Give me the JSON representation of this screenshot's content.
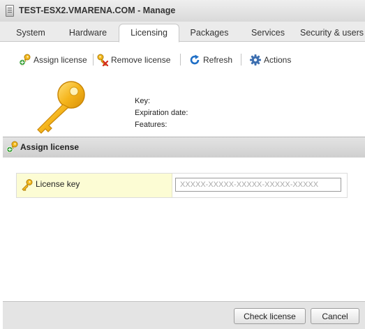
{
  "window": {
    "title": "TEST-ESX2.VMARENA.COM - Manage"
  },
  "tabs": [
    {
      "label": "System"
    },
    {
      "label": "Hardware"
    },
    {
      "label": "Licensing"
    },
    {
      "label": "Packages"
    },
    {
      "label": "Services"
    },
    {
      "label": "Security & users"
    }
  ],
  "active_tab": "Licensing",
  "toolbar": {
    "assign_label": "Assign license",
    "remove_label": "Remove license",
    "refresh_label": "Refresh",
    "actions_label": "Actions"
  },
  "license_info": {
    "key_label": "Key:",
    "expiration_label": "Expiration date:",
    "features_label": "Features:"
  },
  "dialog": {
    "title": "Assign license",
    "field_label": "License key",
    "placeholder": "XXXXX-XXXXX-XXXXX-XXXXX-XXXXX",
    "value": ""
  },
  "footer": {
    "check_label": "Check license",
    "cancel_label": "Cancel"
  },
  "icons": {
    "host": "host-icon",
    "assign": "key-plus-icon",
    "remove": "key-x-icon",
    "refresh": "refresh-icon",
    "actions": "gear-icon",
    "license": "key-icon"
  },
  "colors": {
    "key_gold": "#f2b81c",
    "refresh_blue": "#1f6fc6",
    "gear_blue": "#3d6fb0",
    "label_cell_bg": "#fcfcd4"
  }
}
